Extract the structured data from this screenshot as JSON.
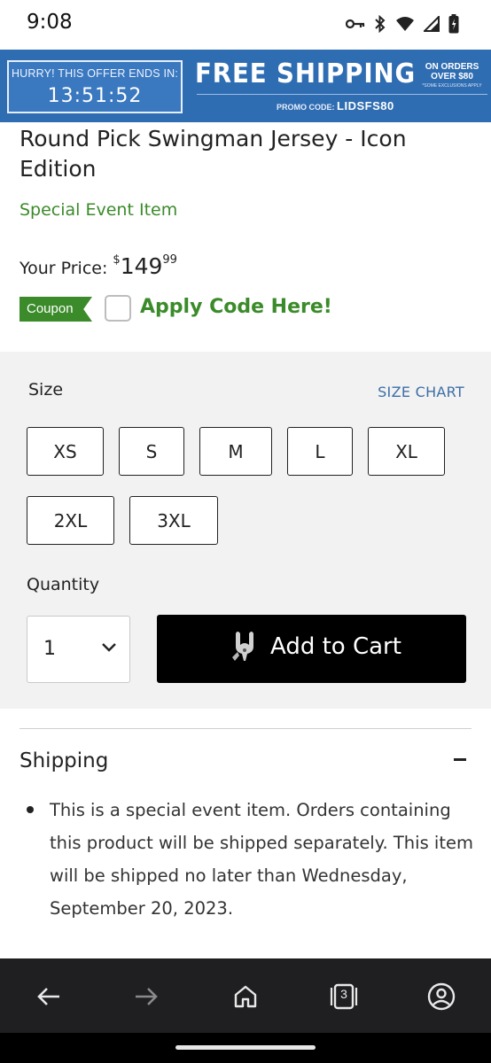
{
  "status_bar": {
    "time": "9:08",
    "icons": [
      "vpn-key-icon",
      "bluetooth-icon",
      "wifi-icon",
      "signal-icon",
      "battery-icon"
    ]
  },
  "promo_banner": {
    "timer_label": "HURRY! THIS OFFER ENDS IN:",
    "timer_value": "13:51:52",
    "headline": "FREE SHIPPING",
    "on_orders_line1": "ON ORDERS",
    "on_orders_line2": "OVER $80",
    "exclusions": "*SOME EXCLUSIONS APPLY",
    "promo_code_label": "PROMO CODE:",
    "promo_code": "LIDSFS80",
    "background_color": "#2f6db2"
  },
  "product": {
    "title_line1": "Round Pick Swingman Jersey - Icon",
    "title_line2": "Edition",
    "event_label": "Special Event Item",
    "price_label": "Your Price:",
    "price_currency": "$",
    "price_whole": "149",
    "price_cents": "99",
    "coupon_badge": "Coupon",
    "apply_code": "Apply Code Here!",
    "accent_color": "#3b8b2a"
  },
  "options": {
    "size_label": "Size",
    "size_chart_link": "SIZE CHART",
    "sizes": [
      "XS",
      "S",
      "M",
      "L",
      "XL",
      "2XL",
      "3XL"
    ],
    "quantity_label": "Quantity",
    "quantity_value": "1",
    "add_to_cart": "Add to Cart"
  },
  "shipping": {
    "title": "Shipping",
    "toggle": "collapse",
    "text": "This is a special event item. Orders containing this product will be shipped separately. This item will be shipped no later than Wednesday, September 20, 2023."
  },
  "browser_nav": {
    "tab_count": "3",
    "icons": [
      "back-arrow-icon",
      "forward-arrow-icon",
      "home-icon",
      "tabs-icon",
      "account-icon"
    ]
  }
}
